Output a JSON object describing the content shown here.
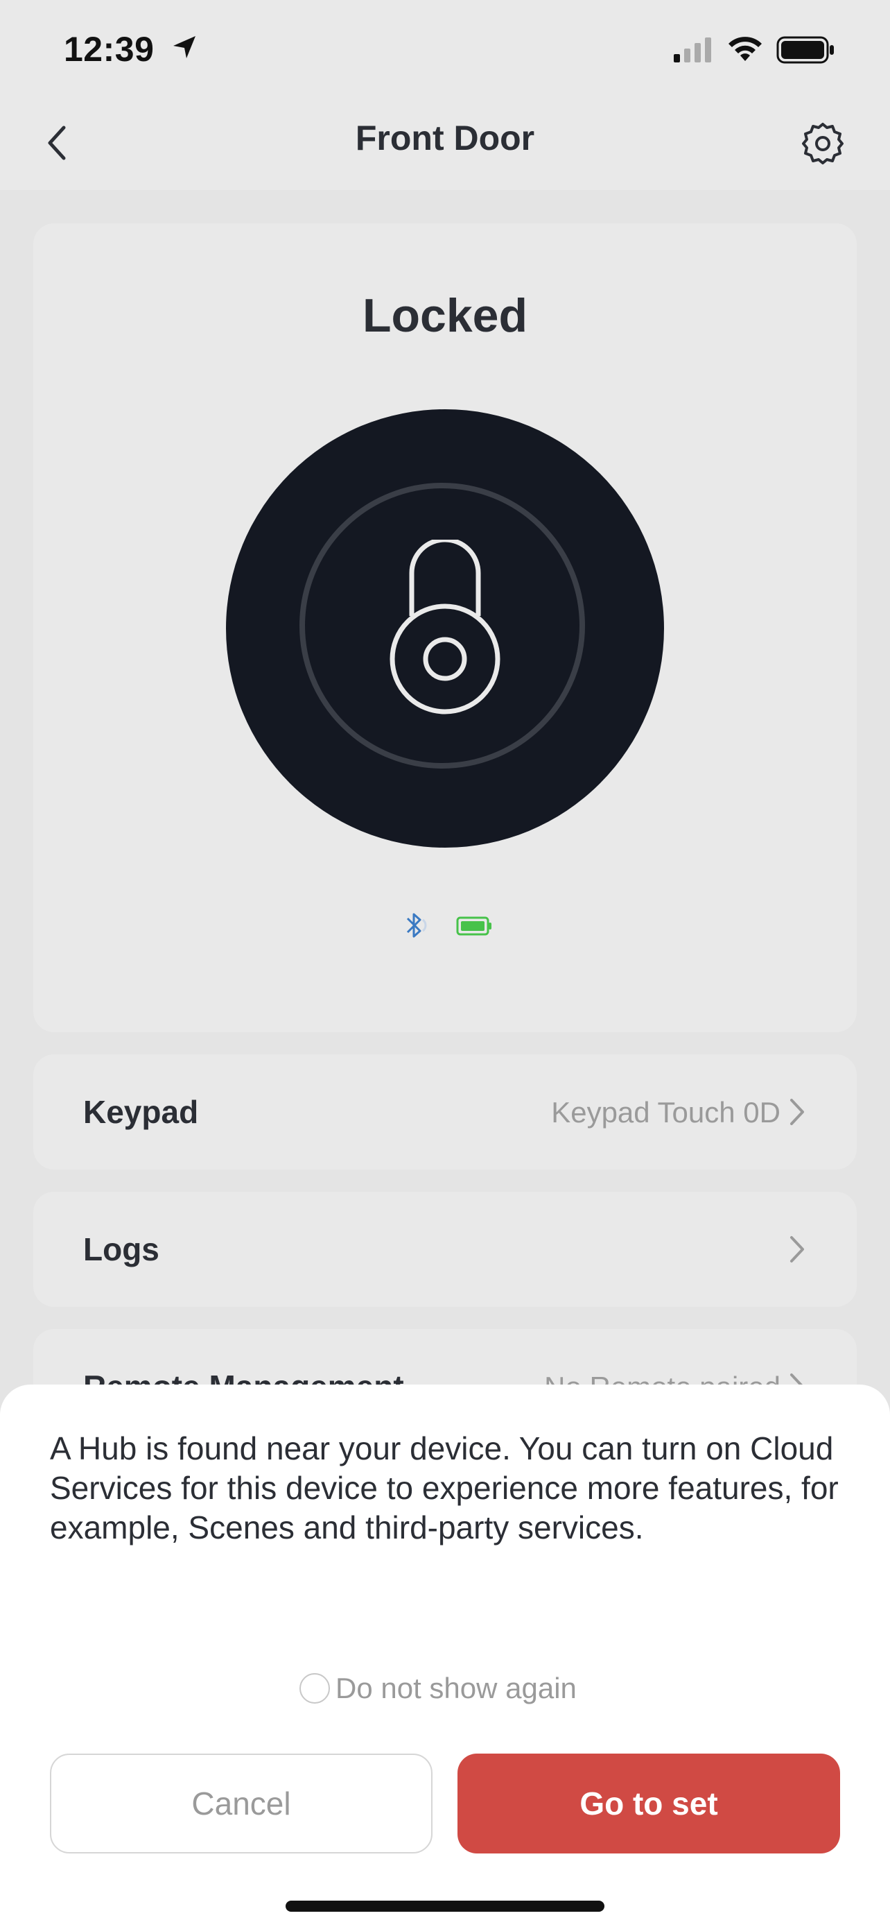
{
  "status_bar": {
    "time": "12:39"
  },
  "header": {
    "title": "Front Door"
  },
  "lock": {
    "status": "Locked",
    "battery_color": "#47c24a",
    "bluetooth_color": "#3a79c2"
  },
  "rows": [
    {
      "label": "Keypad",
      "value": "Keypad Touch 0D"
    },
    {
      "label": "Logs",
      "value": ""
    },
    {
      "label": "Remote Management",
      "value": "No Remote paired"
    }
  ],
  "sheet": {
    "message": "A Hub is found near your device. You can turn on Cloud Services for this device to experience more features, for example, Scenes and third-party services.",
    "checkbox_label": "Do not show again",
    "cancel_label": "Cancel",
    "confirm_label": "Go to set",
    "confirm_color": "#d04a44"
  }
}
